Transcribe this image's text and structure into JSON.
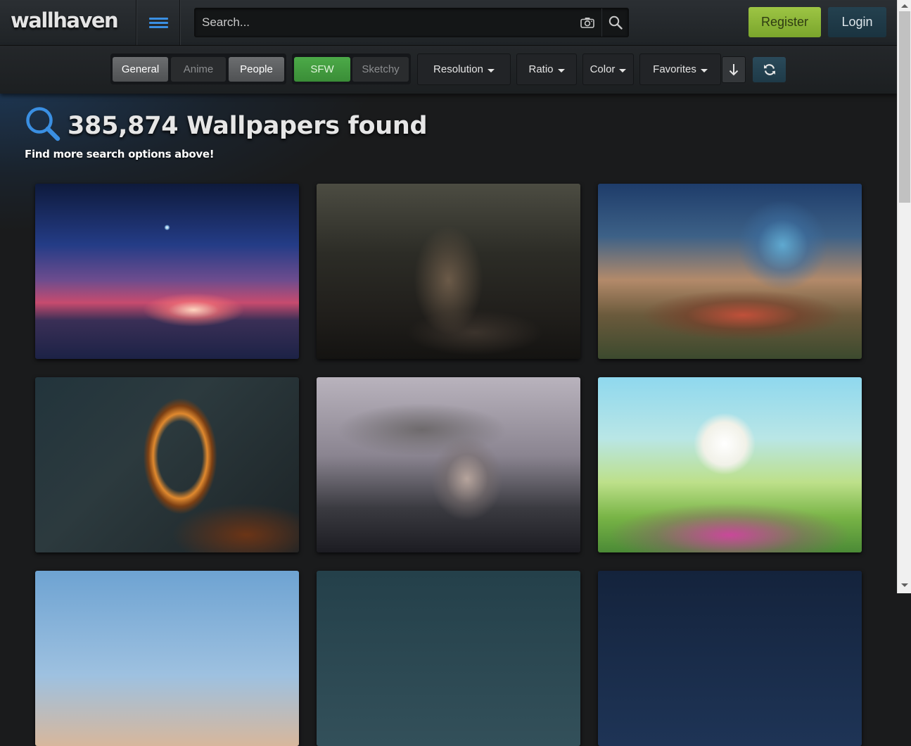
{
  "header": {
    "logo_text": "wallhaven",
    "menu_icon": "hamburger-icon",
    "search_placeholder": "Search...",
    "camera_icon": "camera-icon",
    "search_icon": "search-icon",
    "register_label": "Register",
    "login_label": "Login",
    "accent_color": "#3a8fe2"
  },
  "filters": {
    "categories": [
      {
        "label": "General",
        "active": true
      },
      {
        "label": "Anime",
        "active": false
      },
      {
        "label": "People",
        "active": true
      }
    ],
    "purity": [
      {
        "label": "SFW",
        "active": true
      },
      {
        "label": "Sketchy",
        "active": false
      }
    ],
    "resolution_label": "Resolution",
    "ratio_label": "Ratio",
    "color_label": "Color",
    "sort_label": "Favorites",
    "sort_direction_icon": "arrow-down-icon",
    "refresh_icon": "refresh-icon"
  },
  "results": {
    "count_text": "385,874 Wallpapers found",
    "subtitle": "Find more search options above!"
  },
  "thumbnails": [
    {
      "name": "wallpaper-starry-sky-clouds"
    },
    {
      "name": "wallpaper-woman-lounging-dark-room"
    },
    {
      "name": "wallpaper-fantasy-landscape-portal"
    },
    {
      "name": "wallpaper-space-ring-structure"
    },
    {
      "name": "wallpaper-woman-conical-hat-snow"
    },
    {
      "name": "wallpaper-white-tree-meadow"
    },
    {
      "name": "wallpaper-partial-sky-clouds"
    },
    {
      "name": "wallpaper-partial-dark-teal"
    },
    {
      "name": "wallpaper-partial-night-blue"
    }
  ]
}
